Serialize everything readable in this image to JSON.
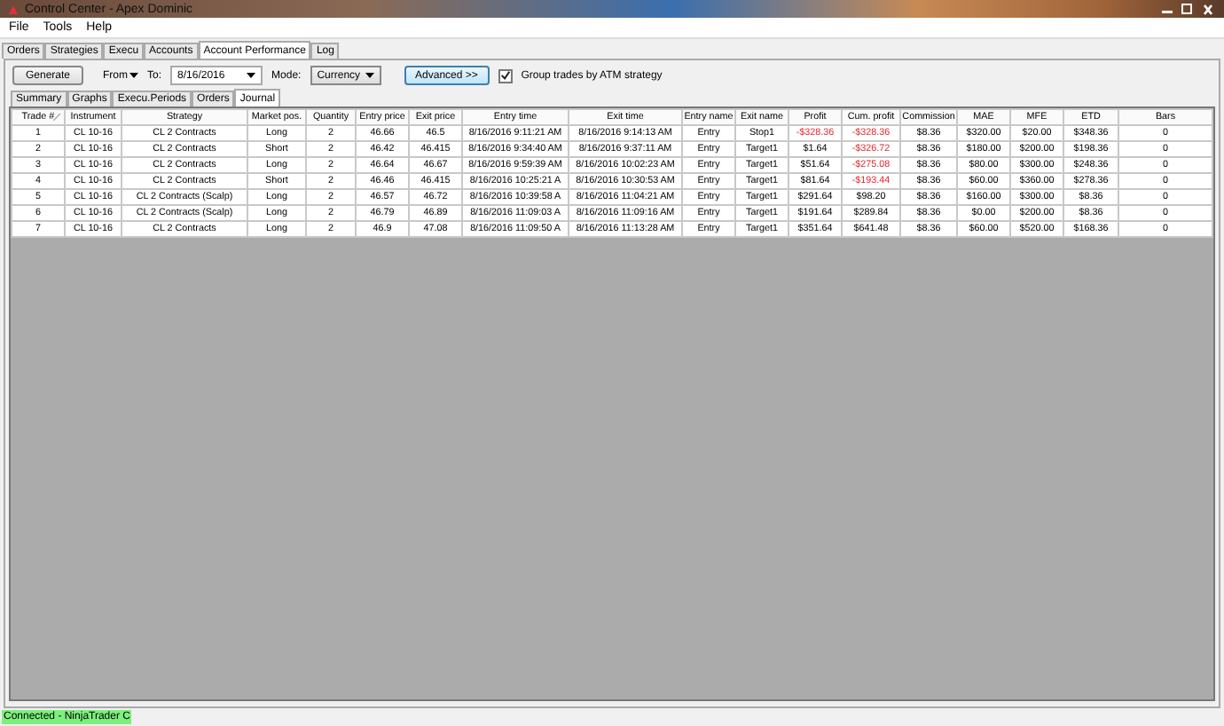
{
  "window": {
    "title": "Control Center - Apex Dominic"
  },
  "menu": [
    "File",
    "Tools",
    "Help"
  ],
  "tabs": [
    {
      "label": "Orders",
      "selected": false
    },
    {
      "label": "Strategies",
      "selected": false
    },
    {
      "label": "Execu",
      "selected": false
    },
    {
      "label": "Accounts",
      "selected": false
    },
    {
      "label": "Account Performance",
      "selected": true
    },
    {
      "label": "Log",
      "selected": false
    }
  ],
  "toolbar": {
    "generate": "Generate",
    "from": "From",
    "to_label": "To:",
    "to_value": "8/16/2016",
    "mode_label": "Mode:",
    "mode_value": "Currency",
    "advanced": "Advanced >>",
    "group_trades": {
      "label": "Group trades by ATM strategy",
      "checked": true
    }
  },
  "subtabs": [
    {
      "label": "Summary",
      "selected": false
    },
    {
      "label": "Graphs",
      "selected": false
    },
    {
      "label": "Execu.Periods",
      "selected": false
    },
    {
      "label": "Orders",
      "selected": false
    },
    {
      "label": "Journal",
      "selected": true
    }
  ],
  "table": {
    "columns": [
      "Trade #",
      "Instrument",
      "Strategy",
      "Market pos.",
      "Quantity",
      "Entry price",
      "Exit price",
      "Entry time",
      "Exit time",
      "Entry name",
      "Exit name",
      "Profit",
      "Cum. profit",
      "Commission",
      "MAE",
      "MFE",
      "ETD",
      "Bars"
    ],
    "rows": [
      {
        "cells": [
          "1",
          "CL 10-16",
          "CL 2 Contracts",
          "Long",
          "2",
          "46.66",
          "46.5",
          "8/16/2016 9:11:21 AM",
          "8/16/2016 9:14:13 AM",
          "Entry",
          "Stop1",
          "-$328.36",
          "-$328.36",
          "$8.36",
          "$320.00",
          "$20.00",
          "$348.36",
          "0"
        ],
        "profit_negative": true,
        "cum_profit_negative": true
      },
      {
        "cells": [
          "2",
          "CL 10-16",
          "CL 2 Contracts",
          "Short",
          "2",
          "46.42",
          "46.415",
          "8/16/2016 9:34:40 AM",
          "8/16/2016 9:37:11 AM",
          "Entry",
          "Target1",
          "$1.64",
          "-$326.72",
          "$8.36",
          "$180.00",
          "$200.00",
          "$198.36",
          "0"
        ],
        "profit_negative": false,
        "cum_profit_negative": true
      },
      {
        "cells": [
          "3",
          "CL 10-16",
          "CL 2 Contracts",
          "Long",
          "2",
          "46.64",
          "46.67",
          "8/16/2016 9:59:39 AM",
          "8/16/2016 10:02:23 AM",
          "Entry",
          "Target1",
          "$51.64",
          "-$275.08",
          "$8.36",
          "$80.00",
          "$300.00",
          "$248.36",
          "0"
        ],
        "profit_negative": false,
        "cum_profit_negative": true
      },
      {
        "cells": [
          "4",
          "CL 10-16",
          "CL 2 Contracts",
          "Short",
          "2",
          "46.46",
          "46.415",
          "8/16/2016 10:25:21 A",
          "8/16/2016 10:30:53 AM",
          "Entry",
          "Target1",
          "$81.64",
          "-$193.44",
          "$8.36",
          "$60.00",
          "$360.00",
          "$278.36",
          "0"
        ],
        "profit_negative": false,
        "cum_profit_negative": true
      },
      {
        "cells": [
          "5",
          "CL 10-16",
          "CL 2 Contracts (Scalp)",
          "Long",
          "2",
          "46.57",
          "46.72",
          "8/16/2016 10:39:58 A",
          "8/16/2016 11:04:21 AM",
          "Entry",
          "Target1",
          "$291.64",
          "$98.20",
          "$8.36",
          "$160.00",
          "$300.00",
          "$8.36",
          "0"
        ],
        "profit_negative": false,
        "cum_profit_negative": false
      },
      {
        "cells": [
          "6",
          "CL 10-16",
          "CL 2 Contracts (Scalp)",
          "Long",
          "2",
          "46.79",
          "46.89",
          "8/16/2016 11:09:03 A",
          "8/16/2016 11:09:16 AM",
          "Entry",
          "Target1",
          "$191.64",
          "$289.84",
          "$8.36",
          "$0.00",
          "$200.00",
          "$8.36",
          "0"
        ],
        "profit_negative": false,
        "cum_profit_negative": false
      },
      {
        "cells": [
          "7",
          "CL 10-16",
          "CL 2 Contracts",
          "Long",
          "2",
          "46.9",
          "47.08",
          "8/16/2016 11:09:50 A",
          "8/16/2016 11:13:28 AM",
          "Entry",
          "Target1",
          "$351.64",
          "$641.48",
          "$8.36",
          "$60.00",
          "$520.00",
          "$168.36",
          "0"
        ],
        "profit_negative": false,
        "cum_profit_negative": false
      }
    ]
  },
  "status_bar": {
    "connection": "Connected - NinjaTrader C"
  }
}
